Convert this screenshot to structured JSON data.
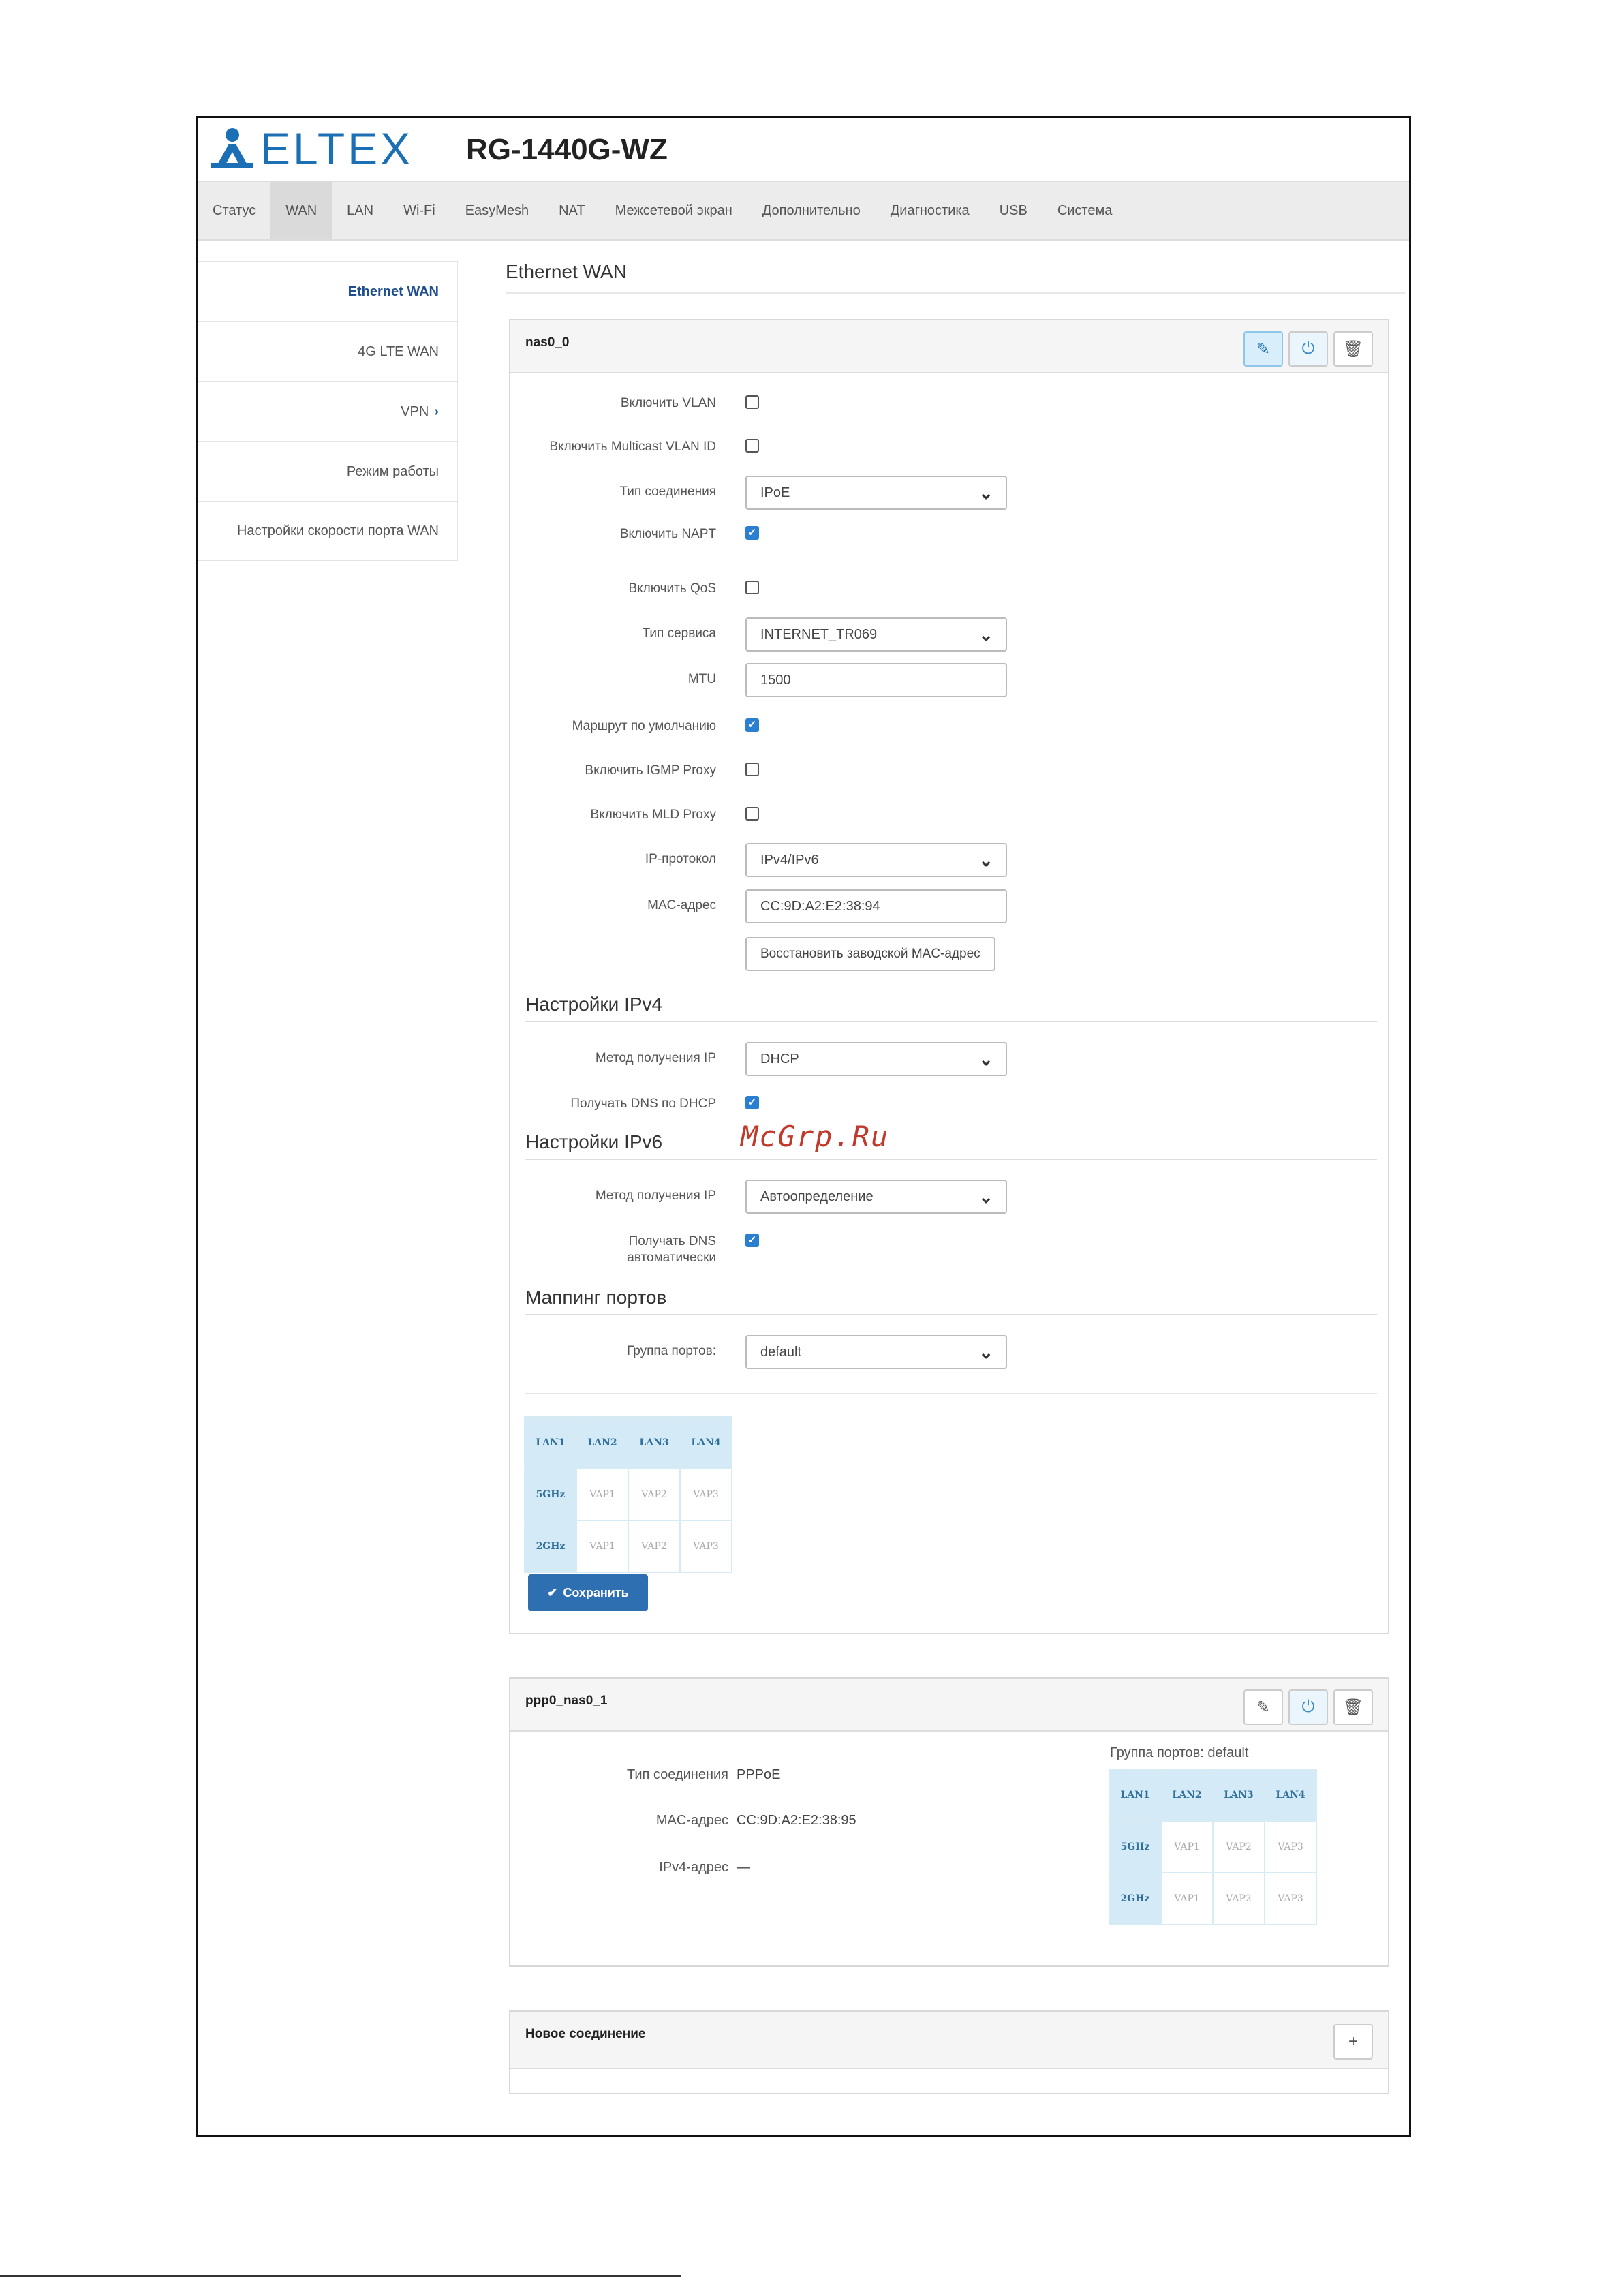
{
  "brand": {
    "logo_text": "ELTEX",
    "model": "RG-1440G-WZ"
  },
  "topnav": [
    "Статус",
    "WAN",
    "LAN",
    "Wi-Fi",
    "EasyMesh",
    "NAT",
    "Межсетевой экран",
    "Дополнительно",
    "Диагностика",
    "USB",
    "Система"
  ],
  "sidebar": {
    "items": [
      "Ethernet WAN",
      "4G LTE WAN",
      "VPN",
      "Режим работы",
      "Настройки скорости порта WAN"
    ]
  },
  "page_title": "Ethernet WAN",
  "panel1": {
    "title": "nas0_0",
    "fields": {
      "vlan_label": "Включить VLAN",
      "mvlan_label": "Включить Multicast VLAN ID",
      "conn_type_label": "Тип соединения",
      "conn_type_value": "IPoE",
      "napt_label": "Включить NAPT",
      "qos_label": "Включить QoS",
      "service_label": "Тип сервиса",
      "service_value": "INTERNET_TR069",
      "mtu_label": "MTU",
      "mtu_value": "1500",
      "defroute_label": "Маршрут по умолчанию",
      "igmp_label": "Включить IGMP Proxy",
      "mld_label": "Включить MLD Proxy",
      "ipproto_label": "IP-протокол",
      "ipproto_value": "IPv4/IPv6",
      "mac_label": "MAC-адрес",
      "mac_value": "CC:9D:A2:E2:38:94",
      "restore_mac": "Восстановить заводской MAC-адрес"
    },
    "ipv4": {
      "heading": "Настройки IPv4",
      "method_label": "Метод получения IP",
      "method_value": "DHCP",
      "dns_label": "Получать DNS по DHCP"
    },
    "ipv6": {
      "heading": "Настройки IPv6",
      "method_label": "Метод получения IP",
      "method_value": "Автоопределение",
      "dns_label_1": "Получать DNS",
      "dns_label_2": "автоматически"
    },
    "mapping": {
      "heading": "Маппинг портов",
      "group_label": "Группа портов:",
      "group_value": "default"
    },
    "save_label": "Сохранить"
  },
  "ports": {
    "row1": [
      "LAN1",
      "LAN2",
      "LAN3",
      "LAN4"
    ],
    "row2": [
      "5GHz",
      "VAP1",
      "VAP2",
      "VAP3"
    ],
    "row3": [
      "2GHz",
      "VAP1",
      "VAP2",
      "VAP3"
    ]
  },
  "panel2": {
    "title": "ppp0_nas0_1",
    "conn_type_label": "Тип соединения",
    "conn_type_value": "PPPoE",
    "mac_label": "MAC-адрес",
    "mac_value": "CC:9D:A2:E2:38:95",
    "ipv4_label": "IPv4-адрес",
    "ipv4_value": "—",
    "group_text": "Группа портов: default"
  },
  "panel3": {
    "title": "Новое соединение"
  },
  "watermark": "McGrp.Ru",
  "colors": {
    "brand": "#1a6fb5",
    "primary_button": "#2e6fb2",
    "port_highlight": "#d4ebf7"
  }
}
